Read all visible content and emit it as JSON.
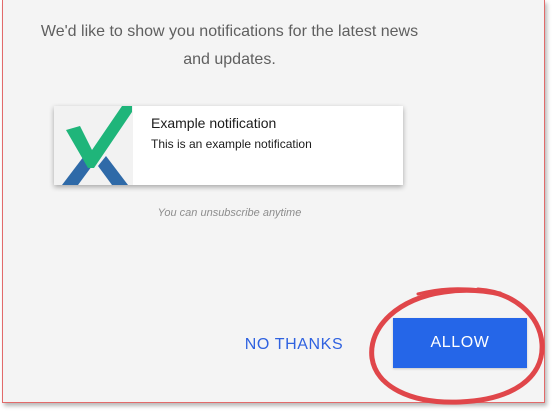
{
  "dialog": {
    "message": "We'd like to show you notifications for the latest news and updates.",
    "unsubscribe_hint": "You can unsubscribe anytime"
  },
  "notification_preview": {
    "title": "Example notification",
    "body": "This is an example notification"
  },
  "actions": {
    "decline_label": "NO THANKS",
    "allow_label": "ALLOW"
  },
  "colors": {
    "accent": "#2566e8",
    "logo_green": "#1fb57a",
    "logo_blue": "#2f6aa8",
    "highlight_red": "#e0464a"
  },
  "icons": {
    "logo": "checkmark-x-logo-icon"
  }
}
